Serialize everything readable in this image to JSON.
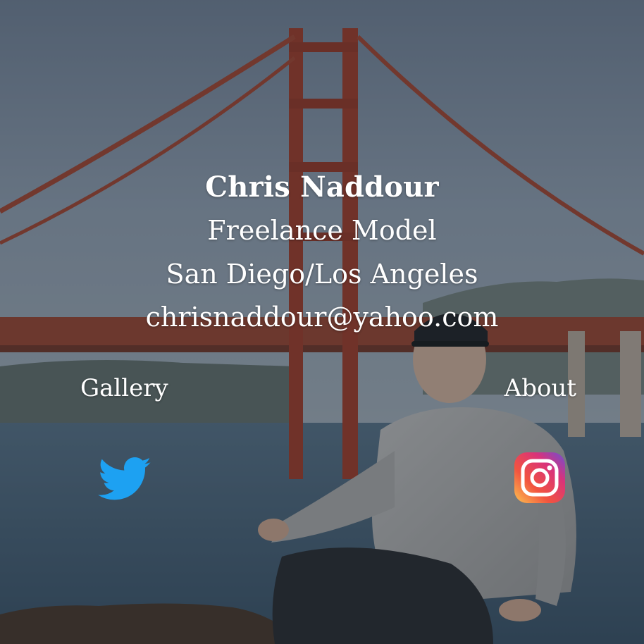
{
  "profile": {
    "name": "Chris Naddour",
    "role": "Freelance Model",
    "location": "San Diego/Los Angeles",
    "email": "chrisnaddour@yahoo.com"
  },
  "nav": {
    "gallery_label": "Gallery",
    "about_label": "About"
  },
  "social": {
    "twitter_icon": "twitter-bird-icon",
    "instagram_icon": "instagram-camera-icon"
  },
  "colors": {
    "text": "#ffffff",
    "twitter_blue": "#1da1f2",
    "bridge_red": "#b0402c"
  }
}
